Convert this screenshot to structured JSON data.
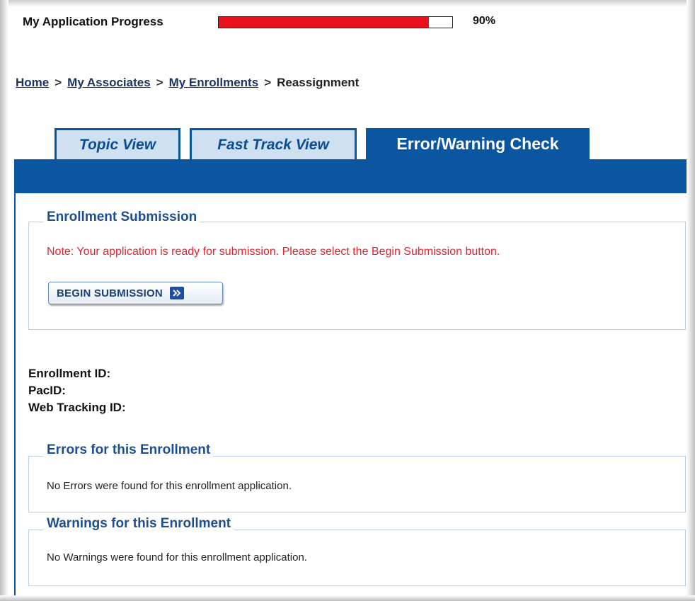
{
  "progress": {
    "label": "My Application Progress",
    "percent_text": "90%",
    "fraction": 0.9,
    "fill_color": "#e8121c"
  },
  "breadcrumb": {
    "items": [
      "Home",
      "My Associates",
      "My Enrollments"
    ],
    "separator": ">",
    "current": "Reassignment"
  },
  "tabs": [
    {
      "label": "Topic View",
      "active": false
    },
    {
      "label": "Fast Track View",
      "active": false
    },
    {
      "label": "Error/Warning Check",
      "active": true
    }
  ],
  "submission": {
    "legend": "Enrollment Submission",
    "note": "Note: Your application is ready for submission. Please select the Begin Submission button.",
    "button_label": "BEGIN SUBMISSION",
    "button_icon": "double-chevron-right-icon"
  },
  "ids": {
    "enrollment_id_label": "Enrollment ID:",
    "pac_id_label": "PacID:",
    "web_tracking_id_label": "Web Tracking ID:"
  },
  "errors": {
    "legend": "Errors for this Enrollment",
    "message": "No Errors were found for this enrollment application."
  },
  "warnings": {
    "legend": "Warnings for this Enrollment",
    "message": "No Warnings were found for this enrollment application."
  },
  "colors": {
    "brand_blue": "#0a56a0",
    "tab_inactive_bg": "#cfe0f1",
    "legend_blue": "#1d4f8f",
    "note_red": "#e0252f"
  }
}
